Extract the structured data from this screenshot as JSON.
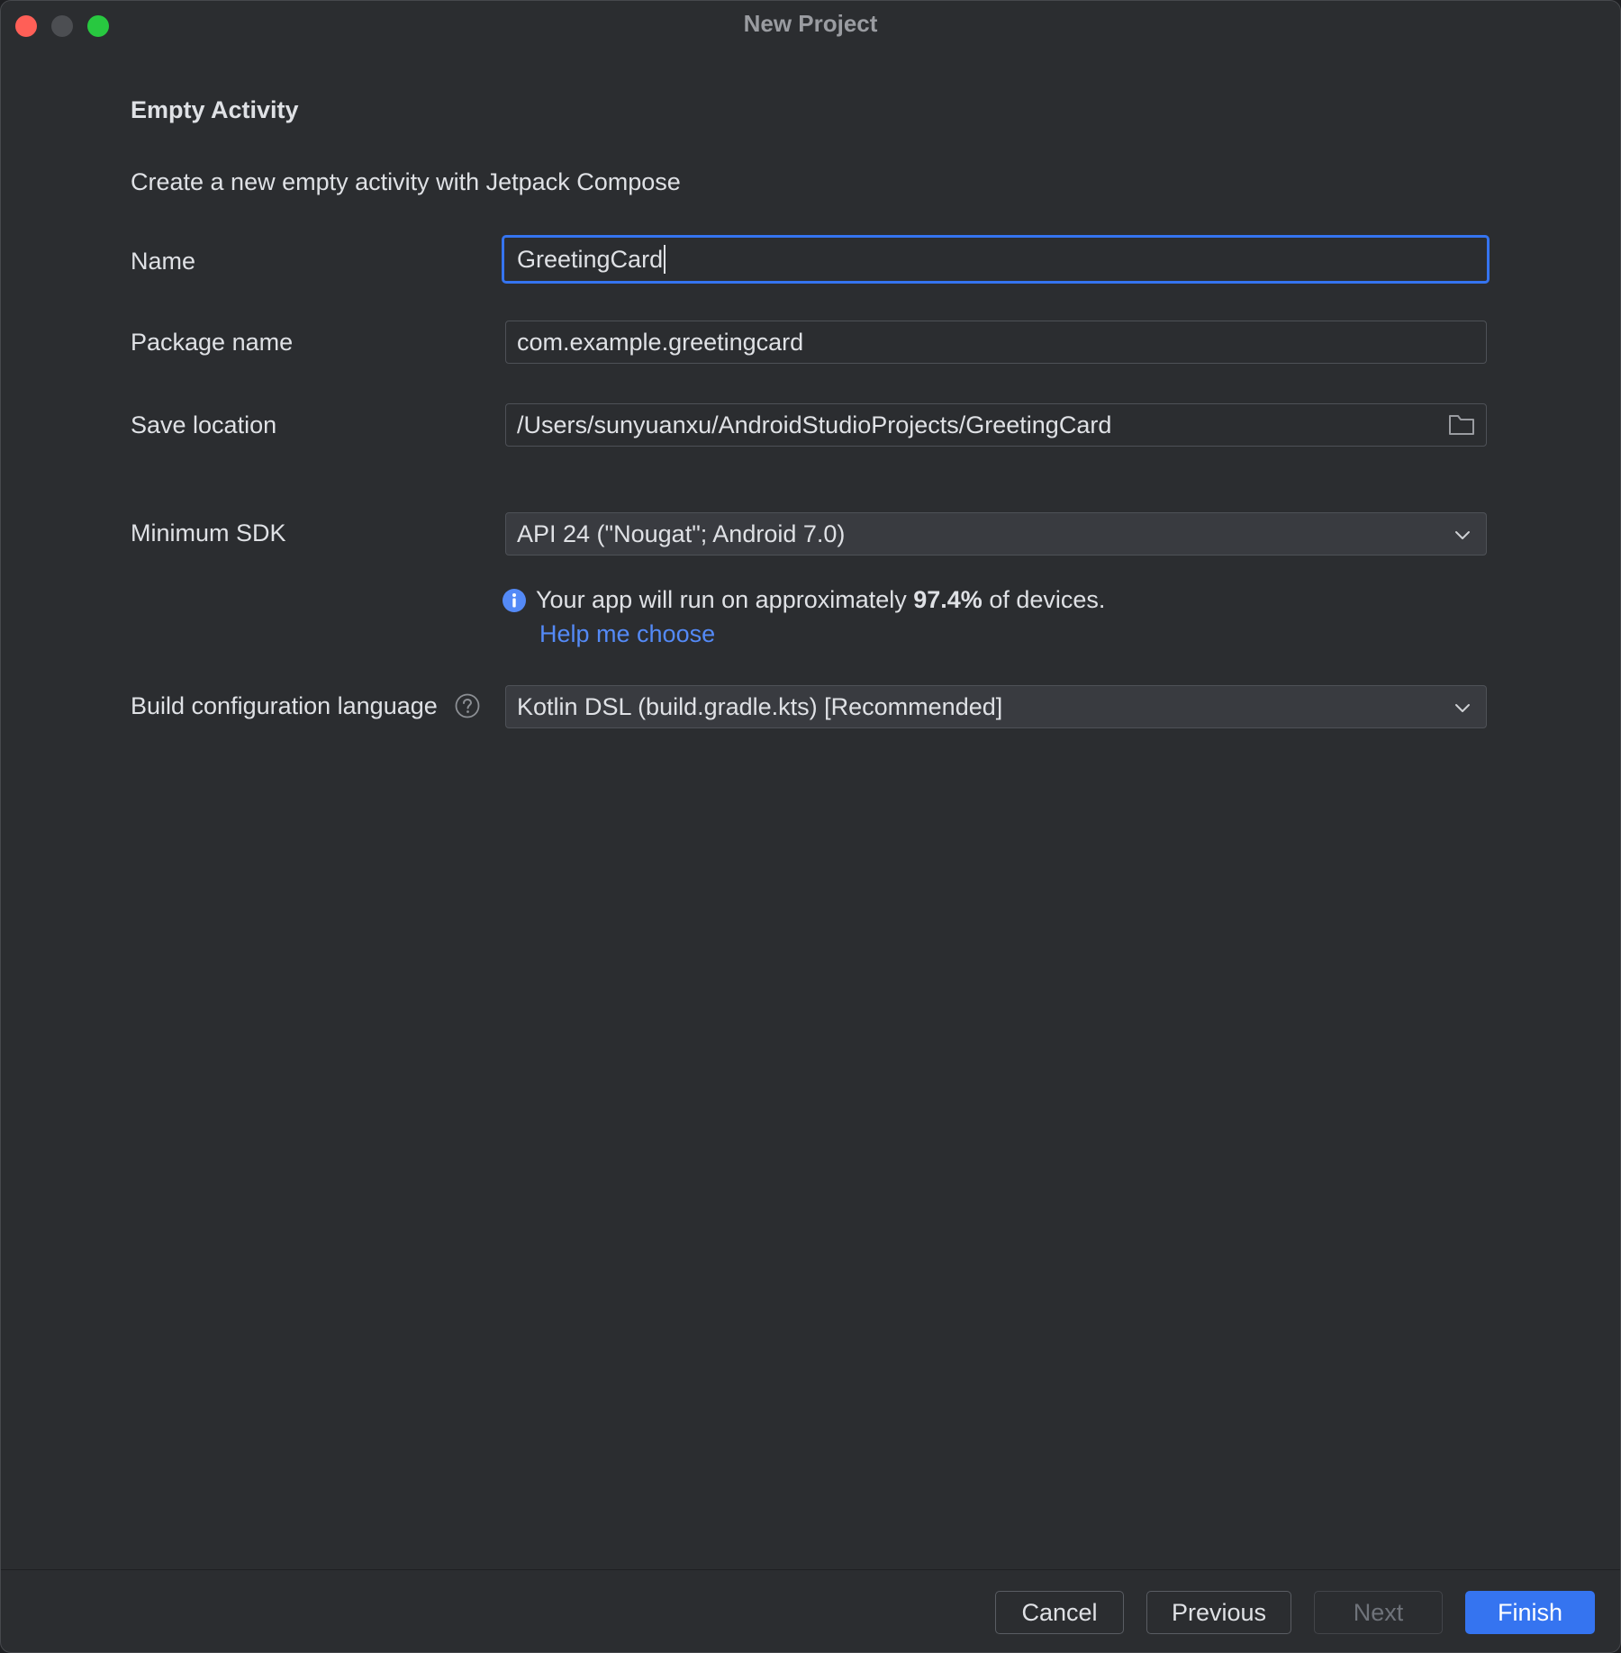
{
  "window": {
    "title": "New Project"
  },
  "template": {
    "heading": "Empty Activity",
    "description": "Create a new empty activity with Jetpack Compose"
  },
  "form": {
    "name": {
      "label": "Name",
      "value": "GreetingCard"
    },
    "package_name": {
      "label": "Package name",
      "value": "com.example.greetingcard"
    },
    "save_location": {
      "label": "Save location",
      "value": "/Users/sunyuanxu/AndroidStudioProjects/GreetingCard",
      "icon": "folder-icon"
    },
    "minimum_sdk": {
      "label": "Minimum SDK",
      "selected": "API 24 (\"Nougat\"; Android 7.0)",
      "info": {
        "prefix": "Your app will run on approximately ",
        "percent": "97.4%",
        "suffix": " of devices.",
        "icon": "info-icon"
      },
      "help_link": "Help me choose"
    },
    "build_language": {
      "label": "Build configuration language",
      "help_icon": "question-icon",
      "selected": "Kotlin DSL (build.gradle.kts) [Recommended]"
    }
  },
  "footer": {
    "cancel": "Cancel",
    "previous": "Previous",
    "next": "Next",
    "finish": "Finish"
  },
  "colors": {
    "accent": "#3574f0",
    "link": "#548af7",
    "background": "#2b2d30",
    "close": "#ff5f57",
    "zoom": "#28c840"
  }
}
